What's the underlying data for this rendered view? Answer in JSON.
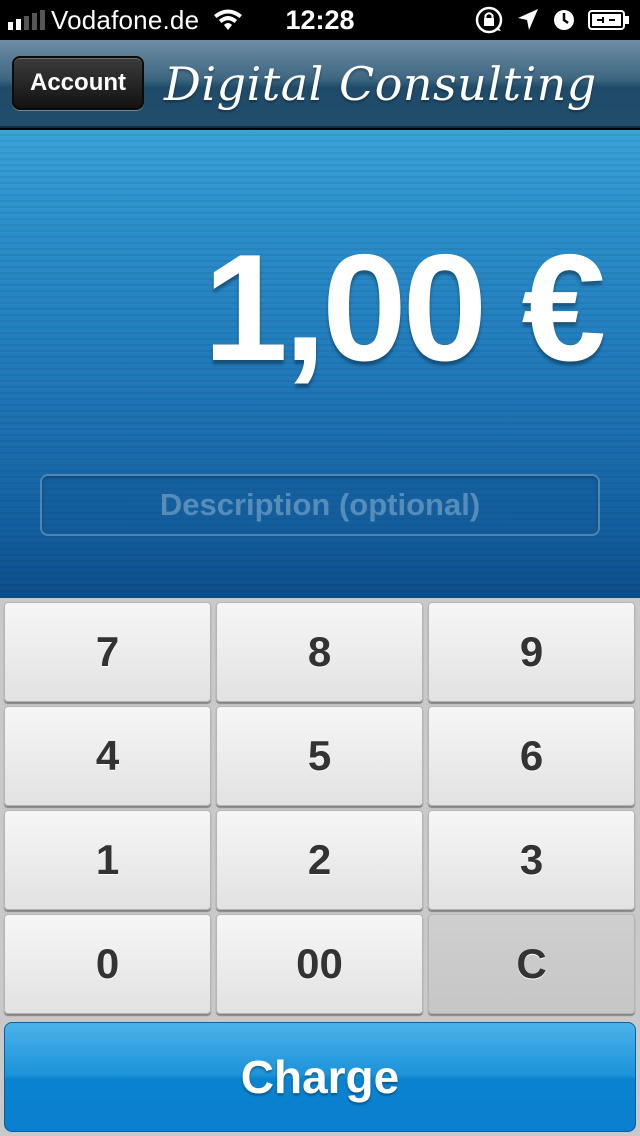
{
  "status_bar": {
    "carrier": "Vodafone.de",
    "time": "12:28",
    "icons": [
      "signal-icon",
      "wifi-icon",
      "rotation-lock-icon",
      "location-icon",
      "alarm-icon",
      "battery-icon"
    ]
  },
  "nav": {
    "account_label": "Account",
    "title": "Digital Consulting"
  },
  "amount": {
    "display": "1,00 €"
  },
  "description": {
    "placeholder": "Description (optional)",
    "value": ""
  },
  "keypad": {
    "keys": [
      "7",
      "8",
      "9",
      "4",
      "5",
      "6",
      "1",
      "2",
      "3",
      "0",
      "00",
      "C"
    ]
  },
  "charge": {
    "label": "Charge"
  },
  "colors": {
    "panel_blue": "#1f77b8",
    "charge_blue": "#1c93d9",
    "key_text": "#333333"
  }
}
